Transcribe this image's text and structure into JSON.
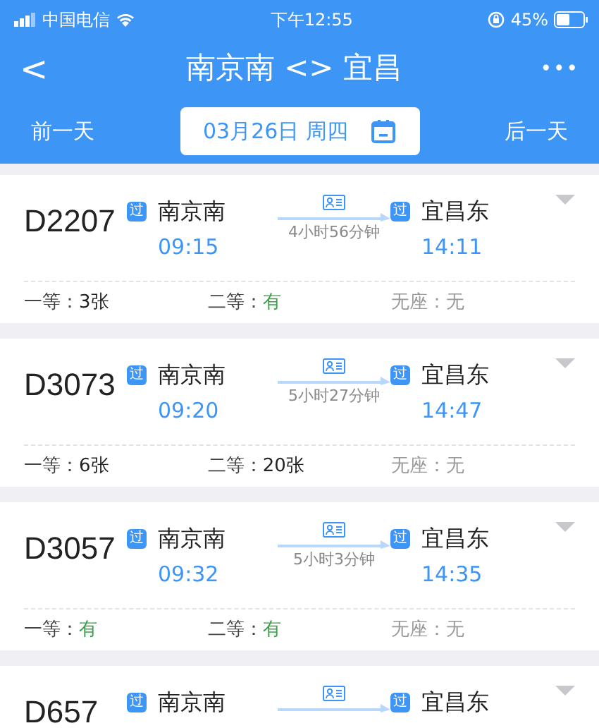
{
  "status_bar": {
    "carrier": "中国电信",
    "time": "下午12:55",
    "battery": "45%"
  },
  "header": {
    "title": "南京南 <> 宜昌",
    "back": "<",
    "more": "•••"
  },
  "date_bar": {
    "prev": "前一天",
    "date": "03月26日 周四",
    "next": "后一天"
  },
  "trains": [
    {
      "number": "D2207",
      "from": "南京南",
      "from_badge": "过",
      "depart": "09:15",
      "duration": "4小时56分钟",
      "to": "宜昌东",
      "to_badge": "过",
      "arrive": "14:11",
      "seats": [
        {
          "label": "一等：",
          "value": "3张",
          "kind": "count"
        },
        {
          "label": "二等：",
          "value": "有",
          "kind": "available"
        },
        {
          "label": "无座：",
          "value": "无",
          "kind": "none"
        }
      ]
    },
    {
      "number": "D3073",
      "from": "南京南",
      "from_badge": "过",
      "depart": "09:20",
      "duration": "5小时27分钟",
      "to": "宜昌东",
      "to_badge": "过",
      "arrive": "14:47",
      "seats": [
        {
          "label": "一等：",
          "value": "6张",
          "kind": "count"
        },
        {
          "label": "二等：",
          "value": "20张",
          "kind": "count"
        },
        {
          "label": "无座：",
          "value": "无",
          "kind": "none"
        }
      ]
    },
    {
      "number": "D3057",
      "from": "南京南",
      "from_badge": "过",
      "depart": "09:32",
      "duration": "5小时3分钟",
      "to": "宜昌东",
      "to_badge": "过",
      "arrive": "14:35",
      "seats": [
        {
          "label": "一等：",
          "value": "有",
          "kind": "available"
        },
        {
          "label": "二等：",
          "value": "有",
          "kind": "available"
        },
        {
          "label": "无座：",
          "value": "无",
          "kind": "none"
        }
      ]
    },
    {
      "number": "D657",
      "from": "南京南",
      "from_badge": "过",
      "to": "宜昌东",
      "to_badge": "过"
    }
  ]
}
